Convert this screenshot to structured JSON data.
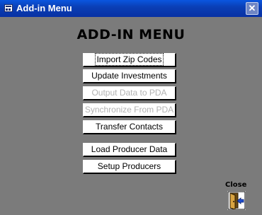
{
  "window": {
    "title": "Add-in Menu",
    "close_glyph": "✕",
    "icon": "form-icon"
  },
  "heading": "ADD-IN MENU",
  "buttons": [
    {
      "label": "Import Zip Codes",
      "enabled": true,
      "focused": true
    },
    {
      "label": "Update Investments",
      "enabled": true
    },
    {
      "label": "Output Data to PDA",
      "enabled": false
    },
    {
      "label": "Synchronize From PDA",
      "enabled": false
    },
    {
      "label": "Transfer Contacts",
      "enabled": true
    },
    {
      "label": "Load Producer Data",
      "enabled": true
    },
    {
      "label": "Setup Producers",
      "enabled": true
    }
  ],
  "close_button": {
    "label": "Close",
    "icon": "exit-door-icon"
  },
  "colors": {
    "background": "#7b7b7b",
    "titlebar": "#0a3fb6",
    "button_face": "#ffffff",
    "disabled_text": "#b2b2b2"
  }
}
